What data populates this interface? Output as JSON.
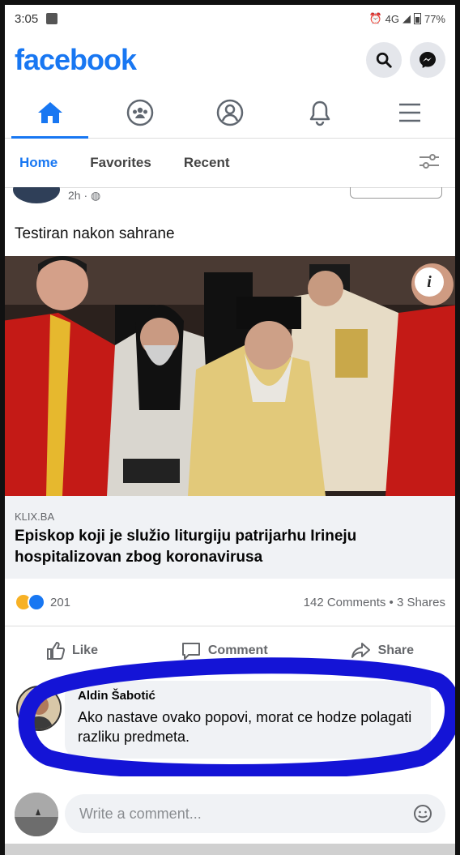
{
  "status": {
    "time": "3:05",
    "network": "4G",
    "battery": "77%"
  },
  "header": {
    "logo": "facebook"
  },
  "tabs": {
    "home": "Home",
    "favorites": "Favorites",
    "recent": "Recent"
  },
  "post": {
    "time": "2h",
    "text": "Testiran nakon sahrane",
    "link": {
      "domain": "KLIX.BA",
      "headline": "Episkop koji je služio liturgiju patrijarhu Irineju hospitalizovan zbog koronavirusa"
    },
    "reactions_count": "201",
    "comments_shares": "142 Comments • 3 Shares",
    "actions": {
      "like": "Like",
      "comment": "Comment",
      "share": "Share"
    }
  },
  "comment": {
    "author": "Aldin Šabotić",
    "text": "Ako nastave ovako popovi, morat ce hodze polagati razliku predmeta."
  },
  "write_comment": {
    "placeholder": "Write a comment..."
  },
  "colors": {
    "brand": "#1877f2",
    "highlight": "#1414d6"
  }
}
